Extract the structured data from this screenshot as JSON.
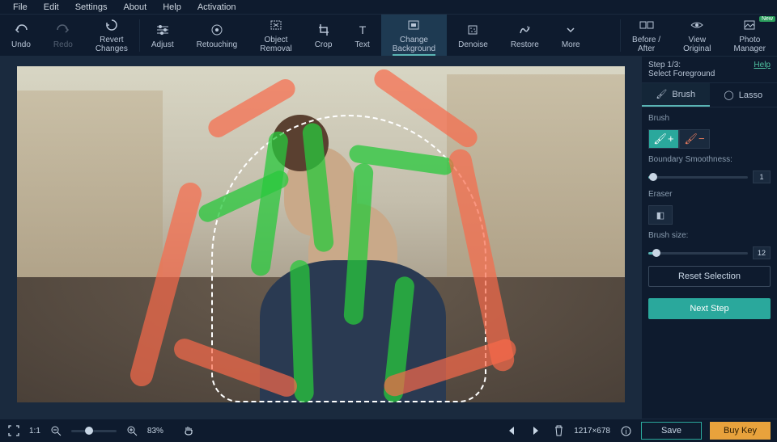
{
  "menubar": [
    "File",
    "Edit",
    "Settings",
    "About",
    "Help",
    "Activation"
  ],
  "toolbar": {
    "undo": "Undo",
    "redo": "Redo",
    "revert": "Revert\nChanges",
    "adjust": "Adjust",
    "retouching": "Retouching",
    "object_removal": "Object\nRemoval",
    "crop": "Crop",
    "text": "Text",
    "change_bg": "Change\nBackground",
    "denoise": "Denoise",
    "restore": "Restore",
    "more": "More",
    "before_after": "Before /\nAfter",
    "view_original": "View\nOriginal",
    "photo_manager": "Photo\nManager",
    "new_badge": "New"
  },
  "sidebar": {
    "step": "Step 1/3:",
    "step_name": "Select Foreground",
    "help": "Help",
    "tab_brush": "Brush",
    "tab_lasso": "Lasso",
    "brush_label": "Brush",
    "boundary_label": "Boundary Smoothness:",
    "boundary_value": "1",
    "eraser_label": "Eraser",
    "brush_size_label": "Brush size:",
    "brush_size_value": "12",
    "reset": "Reset Selection",
    "next": "Next Step"
  },
  "status": {
    "ratio": "1:1",
    "zoom": "83%",
    "dimensions": "1217×678",
    "save": "Save",
    "buykey": "Buy Key"
  }
}
